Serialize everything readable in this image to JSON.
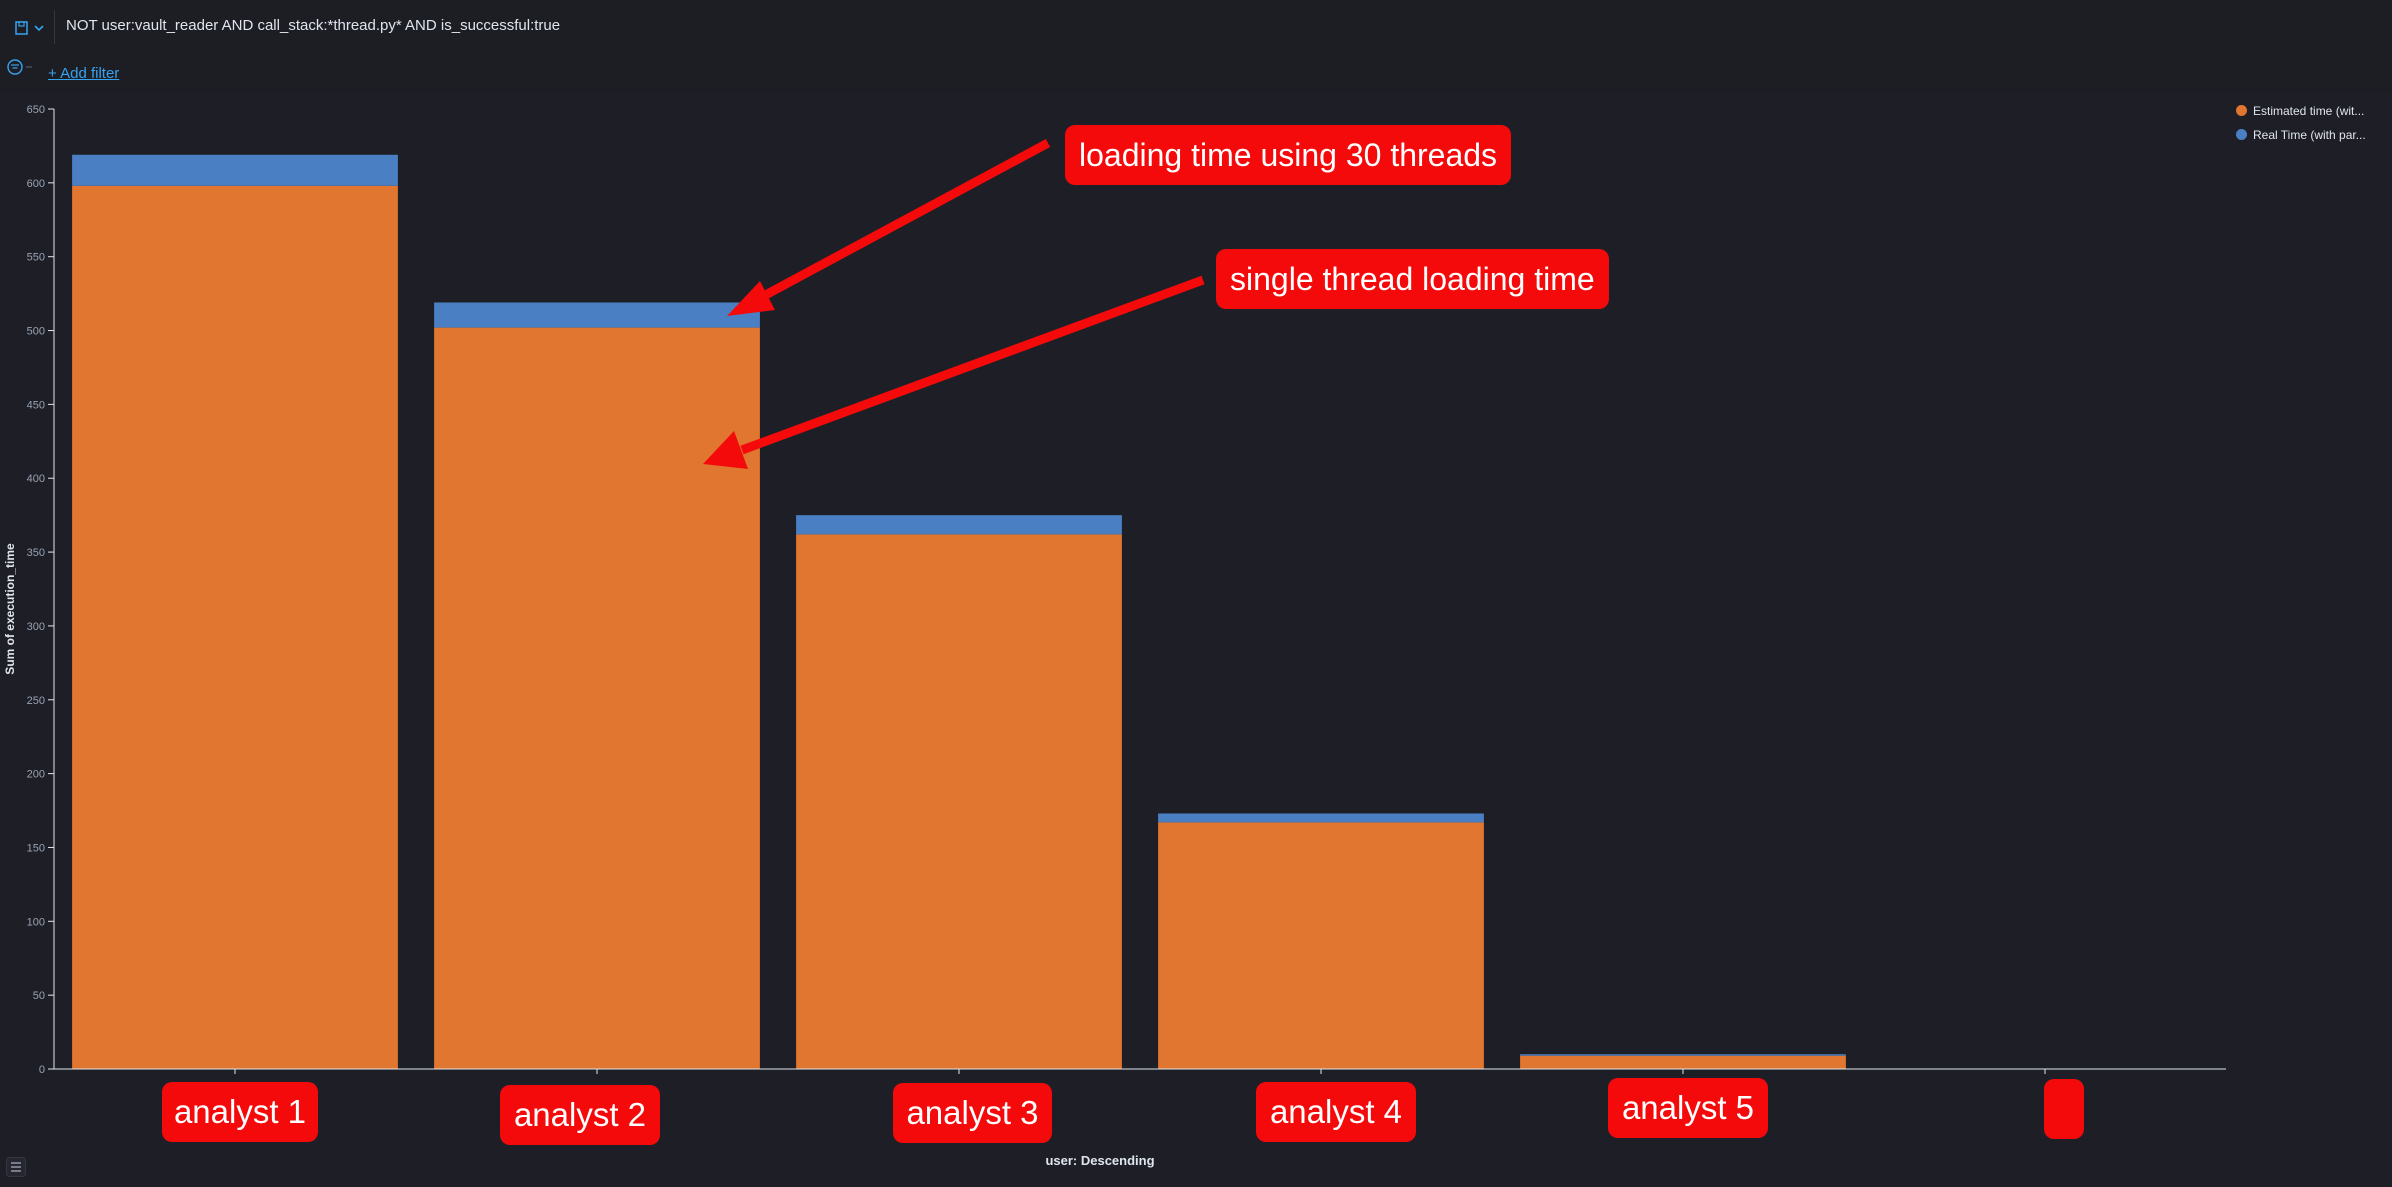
{
  "query": {
    "text": "NOT user:vault_reader AND call_stack:*thread.py* AND is_successful:true"
  },
  "filter_bar": {
    "add_filter_label": "+ Add filter"
  },
  "annotations": {
    "callout_threads": "loading time using 30 threads",
    "callout_single": "single thread loading time",
    "analyst_labels": [
      "analyst 1",
      "analyst 2",
      "analyst 3",
      "analyst 4",
      "analyst 5",
      ""
    ]
  },
  "colors": {
    "estimated": "#e07630",
    "real": "#4a80c3",
    "callout": "#f40a0a"
  },
  "chart_data": {
    "type": "bar",
    "stacked": true,
    "ylabel": "Sum of execution_time",
    "xlabel": "user: Descending",
    "ylim": [
      0,
      650
    ],
    "yticks": [
      0,
      50,
      100,
      150,
      200,
      250,
      300,
      350,
      400,
      450,
      500,
      550,
      600,
      650
    ],
    "categories": [
      "analyst 1",
      "analyst 2",
      "analyst 3",
      "analyst 4",
      "analyst 5",
      ""
    ],
    "series": [
      {
        "name": "Estimated time (wit...",
        "values": [
          598,
          502,
          362,
          167,
          9,
          0
        ]
      },
      {
        "name": "Real Time (with par...",
        "values": [
          21,
          17,
          13,
          6,
          1,
          0
        ]
      }
    ],
    "legend_position": "top-right",
    "grid": false
  }
}
